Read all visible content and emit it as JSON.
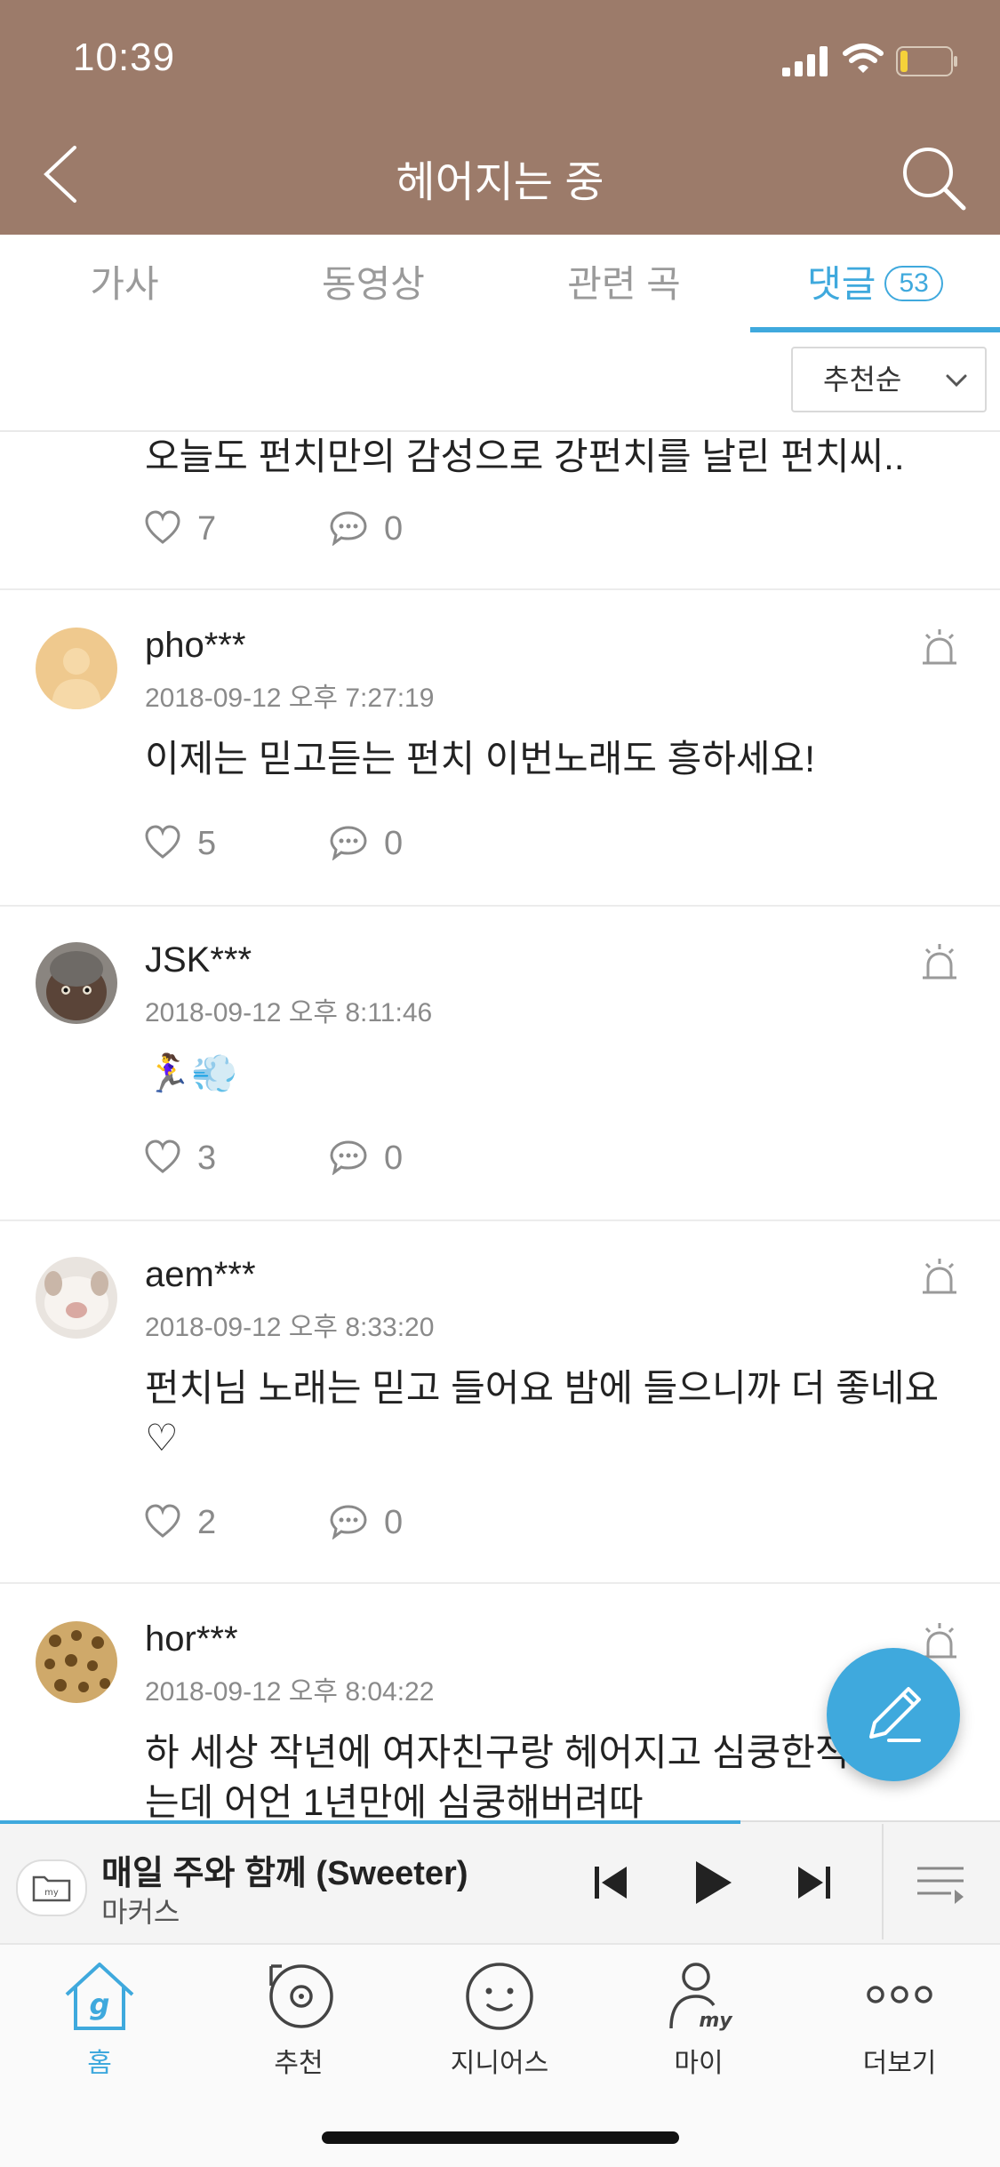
{
  "status_bar": {
    "time": "10:39"
  },
  "header": {
    "title": "헤어지는 중"
  },
  "tabs": [
    {
      "label": "가사"
    },
    {
      "label": "동영상"
    },
    {
      "label": "관련 곡"
    },
    {
      "label": "댓글",
      "count": "53"
    }
  ],
  "sort": {
    "label": "추천순"
  },
  "comments": [
    {
      "text": "오늘도 펀치만의 감성으로 강펀치를 날린 펀치씨..",
      "likes": "7",
      "replies": "0"
    },
    {
      "user": "pho***",
      "date": "2018-09-12 오후 7:27:19",
      "text": "이제는 믿고듣는 펀치 이번노래도 흥하세요!",
      "likes": "5",
      "replies": "0"
    },
    {
      "user": "JSK***",
      "date": "2018-09-12 오후 8:11:46",
      "text": "🏃‍♀️💨",
      "likes": "3",
      "replies": "0"
    },
    {
      "user": "aem***",
      "date": "2018-09-12 오후 8:33:20",
      "text": "펀치님 노래는 믿고 들어요 밤에 들으니까 더 좋네요 ♡",
      "likes": "2",
      "replies": "0"
    },
    {
      "user": "hor***",
      "date": "2018-09-12 오후 8:04:22",
      "text": "하 세상 작년에 여자친구랑 헤어지고 심쿵한적 없었는데 어언 1년만에 심쿵해버려따"
    }
  ],
  "player": {
    "title": "매일 주와 함께 (Sweeter)",
    "artist": "마커스",
    "progress": 0.74
  },
  "bottom_nav": [
    {
      "label": "홈"
    },
    {
      "label": "추천"
    },
    {
      "label": "지니어스"
    },
    {
      "label": "마이"
    },
    {
      "label": "더보기"
    }
  ],
  "colors": {
    "header": "#9c7b6a",
    "accent": "#3fa9dd"
  }
}
